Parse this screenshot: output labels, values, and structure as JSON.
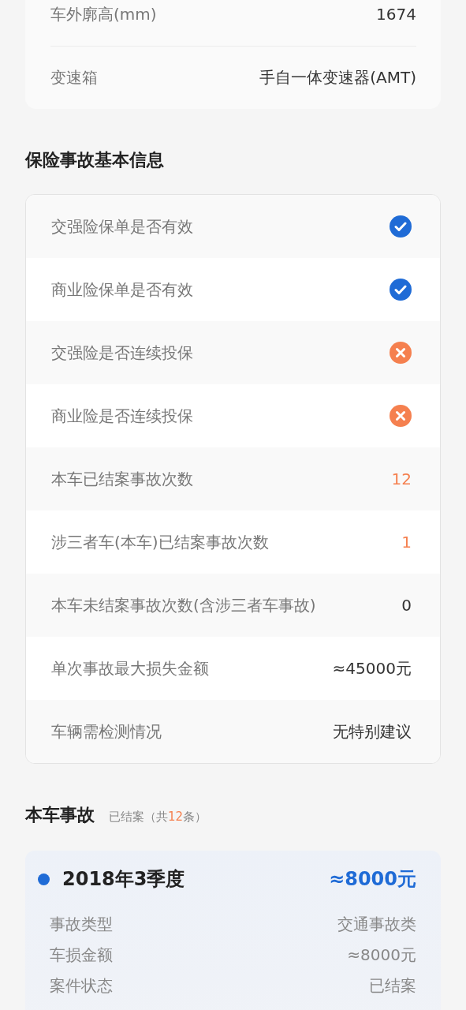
{
  "vehicle_specs": [
    {
      "label": "车外廓高(mm)",
      "value": "1674"
    },
    {
      "label": "变速箱",
      "value": "手自一体变速器(AMT)"
    }
  ],
  "insurance": {
    "title": "保险事故基本信息",
    "rows": [
      {
        "kind": "status",
        "label": "交强险保单是否有效",
        "ok": true
      },
      {
        "kind": "status",
        "label": "商业险保单是否有效",
        "ok": true
      },
      {
        "kind": "status",
        "label": "交强险是否连续投保",
        "ok": false
      },
      {
        "kind": "status",
        "label": "商业险是否连续投保",
        "ok": false
      },
      {
        "kind": "value",
        "label": "本车已结案事故次数",
        "value": "12",
        "highlight": true
      },
      {
        "kind": "value",
        "label": "涉三者车(本车)已结案事故次数",
        "value": "1",
        "highlight": true
      },
      {
        "kind": "value",
        "label": "本车未结案事故次数(含涉三者车事故)",
        "value": "0",
        "highlight": false
      },
      {
        "kind": "value",
        "label": "单次事故最大损失金额",
        "value": "≈45000元",
        "highlight": false
      },
      {
        "kind": "value",
        "label": "车辆需检测情况",
        "value": "无特别建议",
        "highlight": false
      }
    ]
  },
  "accidents": {
    "title": "本车事故",
    "subtitle_prefix": "已结案（共",
    "count": "12",
    "subtitle_suffix": "条）",
    "items": [
      {
        "period": "2018年3季度",
        "amount": "≈8000元",
        "details": [
          {
            "label": "事故类型",
            "value": "交通事故类"
          },
          {
            "label": "车损金额",
            "value": "≈8000元"
          },
          {
            "label": "案件状态",
            "value": "已结案"
          }
        ]
      }
    ]
  }
}
